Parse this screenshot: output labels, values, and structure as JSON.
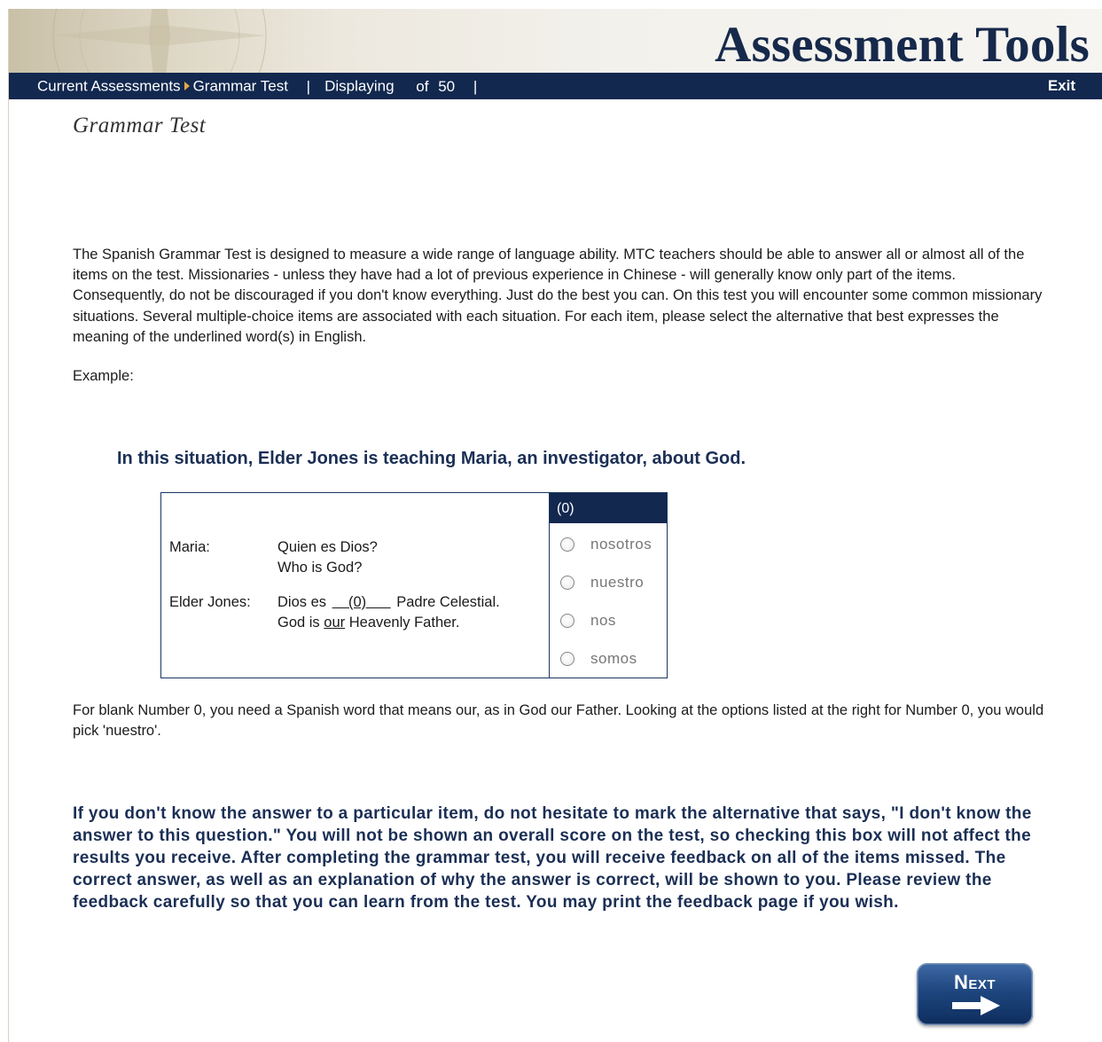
{
  "app": {
    "title": "Assessment Tools"
  },
  "nav": {
    "breadcrumb_root": "Current Assessments",
    "breadcrumb_current": "Grammar Test",
    "separator": "|",
    "displaying_label": "Displaying",
    "of_label": "of",
    "total": "50",
    "exit_label": "Exit"
  },
  "page": {
    "title": "Grammar Test",
    "intro": "The Spanish Grammar Test is designed to measure a wide range of language ability. MTC teachers should be able to answer all or almost all of the items on the test. Missionaries - unless they have had a lot of previous experience in Chinese - will generally know only part of the items. Consequently, do not be discouraged if you don't know everything. Just do the best you can. On this test you will encounter some common missionary situations. Several multiple-choice items are associated with each situation. For each item, please select the alternative that best expresses the meaning of the underlined word(s) in English.",
    "example_label": "Example:",
    "situation": "In this situation, Elder Jones is teaching Maria, an investigator, about God.",
    "explanation": "For blank Number 0, you need a Spanish word that means our, as in God our Father. Looking at the options listed at the right for Number 0, you would pick 'nuestro'.",
    "note": "If you don't know the answer to a particular item, do not hesitate to mark the alternative that says, \"I don't know the answer to this question.\" You will not be shown an overall score on the test, so checking this box will not affect the results you receive. After completing the grammar test, you will receive feedback on all of the items missed. The correct answer, as well as an explanation of why the answer is correct, will be shown to you. Please review the feedback carefully so that you can learn from the test. You may print the feedback page if you wish."
  },
  "example": {
    "speaker1": "Maria:",
    "speaker1_spanish": "Quien es Dios?",
    "speaker1_english": "Who is God?",
    "speaker2": "Elder Jones:",
    "speaker2_spanish_before": "Dios es",
    "blank": "(0)",
    "speaker2_spanish_after": "Padre Celestial.",
    "speaker2_english_before": "God is",
    "speaker2_english_underlined": "our",
    "speaker2_english_after": "Heavenly Father.",
    "options_header": "(0)",
    "options": [
      "nosotros",
      "nuestro",
      "nos",
      "somos"
    ]
  },
  "buttons": {
    "next_label": "Next"
  },
  "colors": {
    "navy": "#12284f",
    "heading": "#1b2f55",
    "crumb_arrow": "#e0a94a"
  }
}
